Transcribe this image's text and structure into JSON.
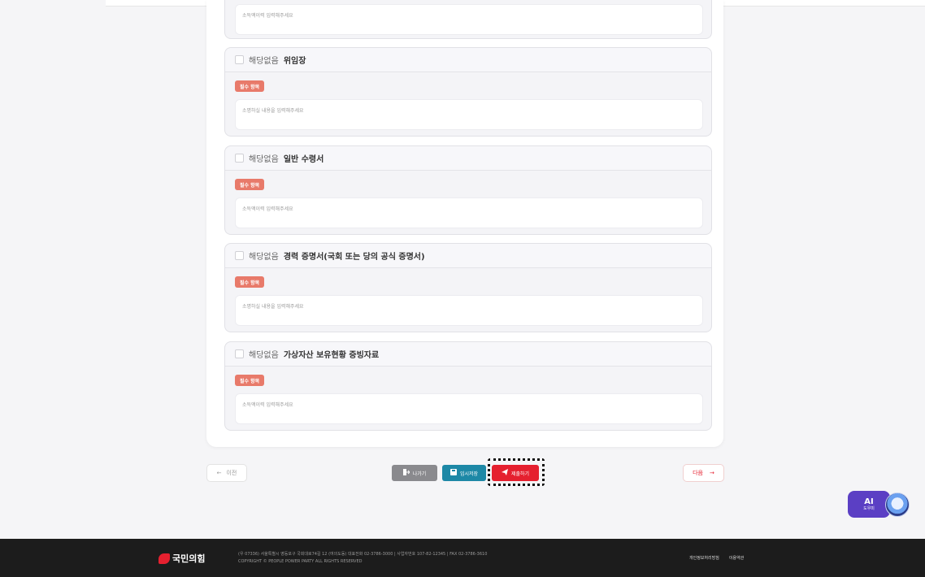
{
  "sections": [
    {
      "prefix": "",
      "title": "",
      "badge": "",
      "placeholder": "소득액이력 입력해주세요"
    },
    {
      "prefix": "해당없음",
      "title": "위임장",
      "badge": "필수 항목",
      "placeholder": "소명하실 내용을 입력해주세요"
    },
    {
      "prefix": "해당없음",
      "title": "일반 수령서",
      "badge": "필수 항목",
      "placeholder": "소득액이력 입력해주세요"
    },
    {
      "prefix": "해당없음",
      "title": "경력 증명서(국회 또는 당의 공식 증명서)",
      "badge": "필수 항목",
      "placeholder": "소명하실 내용을 입력해주세요"
    },
    {
      "prefix": "해당없음",
      "title": "가상자산 보유현황 증빙자료",
      "badge": "필수 항목",
      "placeholder": "소득액이력 입력해주세요"
    }
  ],
  "nav": {
    "prev_label": "이전",
    "exit_label": "나가기",
    "save_label": "임시저장",
    "submit_label": "제출하기",
    "next_label": "다음"
  },
  "ai_button": {
    "title": "AI",
    "subtitle": "도우미"
  },
  "footer": {
    "brand": "국민의힘",
    "line1": "(우 07336) 서울특별시 영등포구 국회대로74길 12 (여의도동)   대표전화 02-3786-3000  |  사업자번호 107-82-12345  |  FAX 02-3786-3610",
    "line2": "COPYRIGHT © PEOPLE POWER PARTY ALL RIGHTS RESERVED",
    "link1": "개인정보처리방침",
    "link2": "이용약관"
  },
  "colors": {
    "accent": "#e5202f",
    "save": "#1d88a6",
    "exit": "#8a8a8e",
    "badge": "#e87a6a",
    "footer_bg": "#1c1c1c",
    "ai": "#5b3fc4"
  }
}
